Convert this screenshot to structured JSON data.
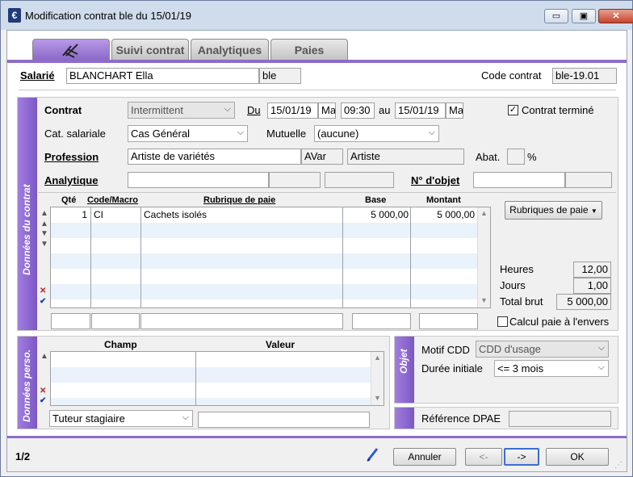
{
  "window": {
    "title": "Modification contrat ble du 15/01/19",
    "app_icon": "€",
    "minimize": "▭",
    "maximize": "▣",
    "close": "✕"
  },
  "tabs": [
    {
      "label": ""
    },
    {
      "label": "Suivi contrat"
    },
    {
      "label": "Analytiques"
    },
    {
      "label": "Paies"
    }
  ],
  "header": {
    "salarie_label": "Salarié",
    "salarie_name": "BLANCHART Ella",
    "salarie_code": "ble",
    "code_contrat_label": "Code contrat",
    "code_contrat_value": "ble-19.01"
  },
  "contrat": {
    "side_title": "Données du contrat",
    "contrat_label": "Contrat",
    "contrat_value": "Intermittent",
    "du_label": "Du",
    "du_date": "15/01/19",
    "du_ampm": "Ma",
    "du_time": "09:30",
    "au_label": "au",
    "au_date": "15/01/19",
    "au_ampm": "Ma",
    "termine_label": "Contrat terminé",
    "termine_check": "✓",
    "cat_label": "Cat. salariale",
    "cat_value": "Cas Général",
    "mutuelle_label": "Mutuelle",
    "mutuelle_value": "(aucune)",
    "profession_label": "Profession",
    "profession_value": "Artiste de variétés",
    "profession_code": "AVar",
    "profession_short": "Artiste",
    "abat_label": "Abat.",
    "abat_value": "",
    "abat_pct": "%",
    "analytique_label": "Analytique",
    "objet_label": "N° d'objet"
  },
  "paie_grid": {
    "headers": {
      "qte": "Qté",
      "code": "Code/Macro",
      "rubrique": "Rubrique de paie",
      "base": "Base",
      "montant": "Montant"
    },
    "rows": [
      {
        "qte": "1",
        "code": "CI",
        "rubrique": "Cachets isolés",
        "base": "5 000,00",
        "montant": "5 000,00"
      }
    ],
    "rubriques_button": "Rubriques de paie",
    "heures_label": "Heures",
    "heures_value": "12,00",
    "jours_label": "Jours",
    "jours_value": "1,00",
    "brut_label": "Total brut",
    "brut_value": "5 000,00",
    "calcul_label": "Calcul paie à l'envers"
  },
  "perso": {
    "side_title": "Données perso.",
    "headers": {
      "champ": "Champ",
      "valeur": "Valeur"
    },
    "tuteur_value": "Tuteur stagiaire"
  },
  "objet": {
    "side_title": "Objet",
    "motif_label": "Motif CDD",
    "motif_value": "CDD d'usage",
    "duree_label": "Durée initiale",
    "duree_value": "<= 3 mois",
    "dpae_label": "Référence DPAE",
    "dpae_value": ""
  },
  "footer": {
    "page": "1/2",
    "annuler": "Annuler",
    "prev": "<-",
    "next": "->",
    "ok": "OK"
  },
  "icons": {
    "up": "▲",
    "down": "▼",
    "delete": "✕",
    "validate": "✔",
    "dropdown": "⌵"
  },
  "colors": {
    "accent": "#8e6cc8",
    "row_alt": "#eaf2fb"
  }
}
